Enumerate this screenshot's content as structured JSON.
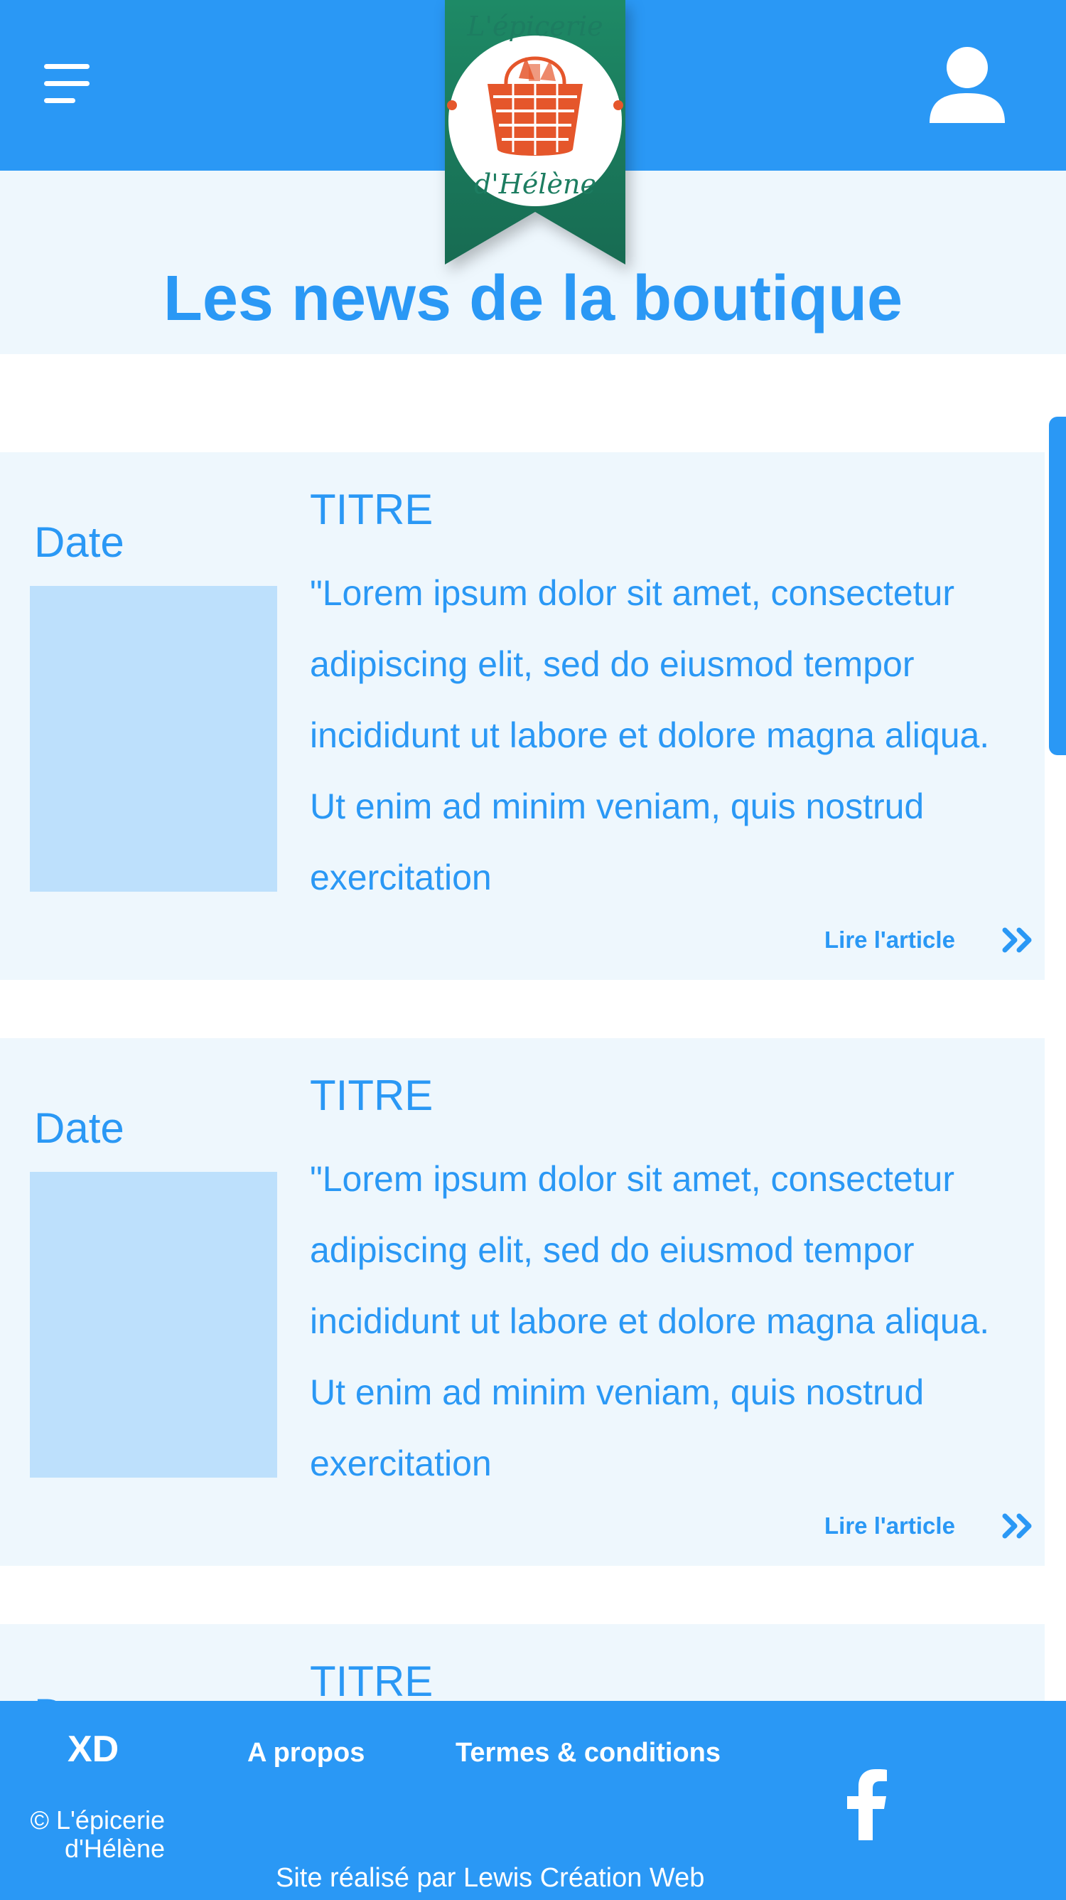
{
  "header": {
    "menu_icon": "hamburger-menu-icon",
    "account_icon": "user-account-icon",
    "logo": {
      "line1": "L'épicerie",
      "line2": "d'Hélène"
    }
  },
  "page": {
    "title": "Les news de la boutique"
  },
  "articles": [
    {
      "date": "Date",
      "title": "TITRE",
      "excerpt": "\"Lorem ipsum dolor sit amet, consectetur adipiscing elit, sed do eiusmod tempor incididunt ut labore et dolore magna aliqua. Ut enim ad minim veniam, quis nostrud exercitation",
      "link_label": "Lire l'article"
    },
    {
      "date": "Date",
      "title": "TITRE",
      "excerpt": "\"Lorem ipsum dolor sit amet, consectetur adipiscing elit, sed do eiusmod tempor incididunt ut labore et dolore magna aliqua. Ut enim ad minim veniam, quis nostrud exercitation",
      "link_label": "Lire l'article"
    },
    {
      "date": "Date",
      "title": "TITRE",
      "excerpt": "",
      "link_label": ""
    }
  ],
  "footer": {
    "brand": "XD",
    "copyright_line1": "© L'épicerie",
    "copyright_line2": "d'Hélène",
    "links": [
      "A propos",
      "Termes & conditions"
    ],
    "credit": "Site réalisé par Lewis Création Web",
    "social_icon": "facebook-icon"
  },
  "colors": {
    "primary": "#2a98f5",
    "card_background": "#eef7fd",
    "thumbnail": "#bde0fc",
    "logo_green": "#1d7d61",
    "logo_orange": "#e5562b"
  }
}
